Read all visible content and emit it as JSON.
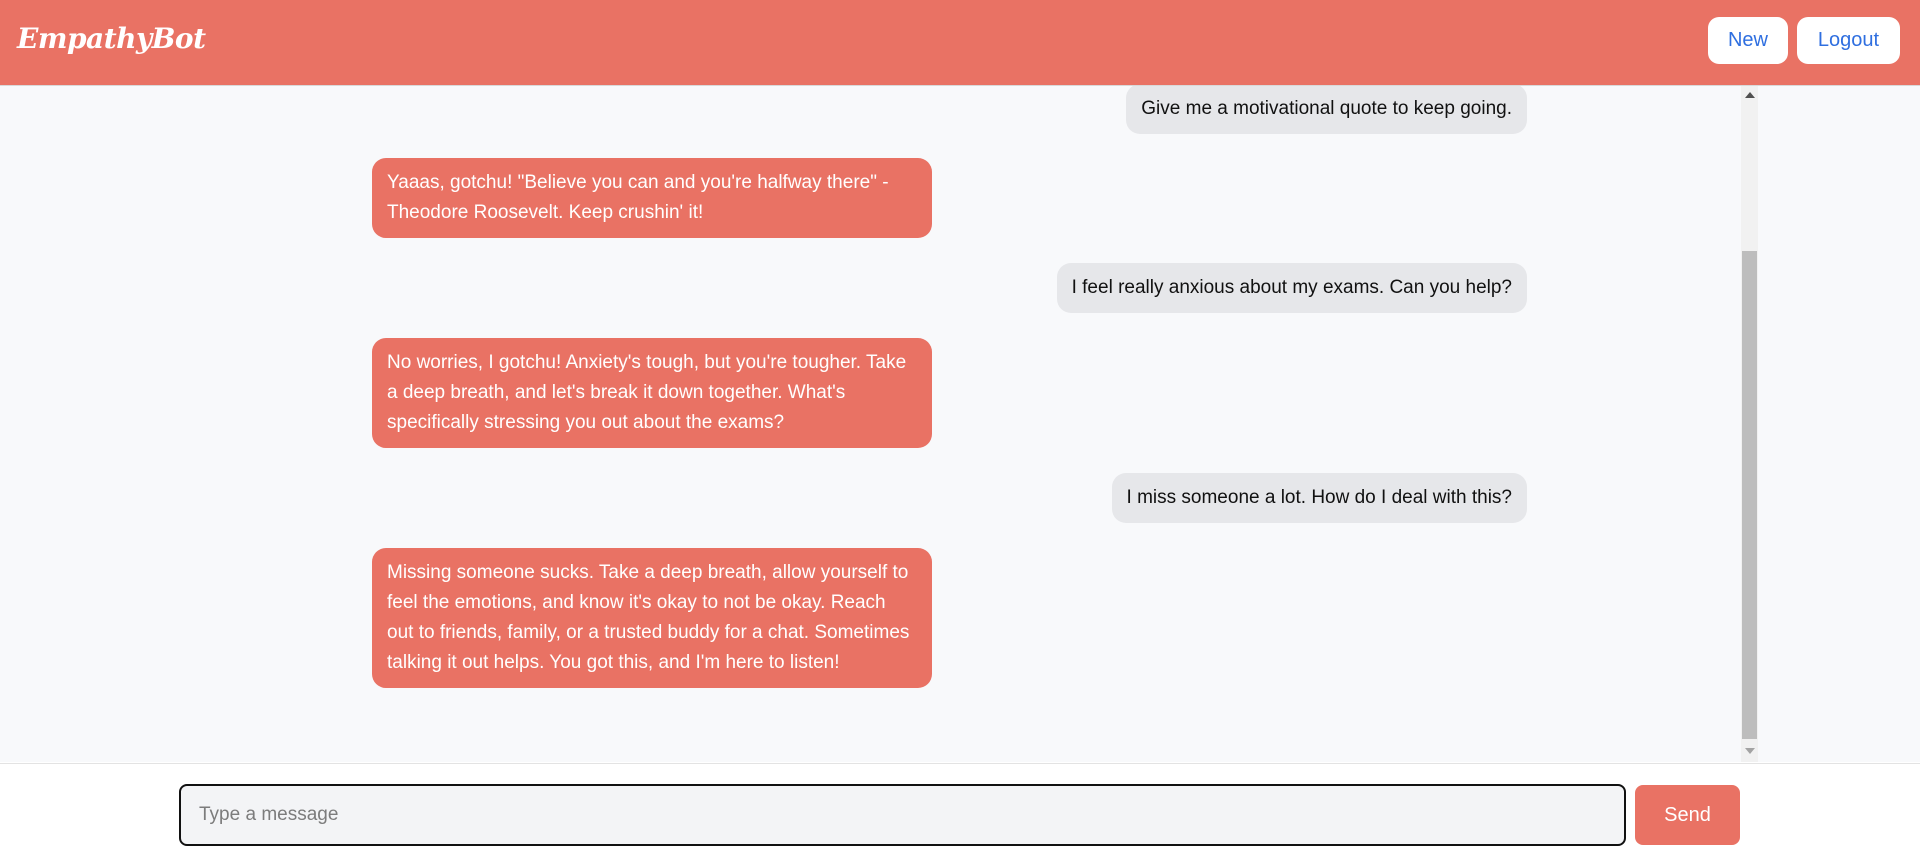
{
  "app": {
    "brand": "EmpathyBot"
  },
  "header": {
    "new_label": "New",
    "logout_label": "Logout"
  },
  "messages": [
    {
      "role": "user",
      "text": "Give me a motivational quote to keep going."
    },
    {
      "role": "bot",
      "text": "Yaaas, gotchu! \"Believe you can and you're halfway there\" - Theodore Roosevelt. Keep crushin' it!"
    },
    {
      "role": "user",
      "text": "I feel really anxious about my exams. Can you help?"
    },
    {
      "role": "bot",
      "text": "No worries, I gotchu! Anxiety's tough, but you're tougher. Take a deep breath, and let's break it down together. What's specifically stressing you out about the exams?"
    },
    {
      "role": "user",
      "text": "I miss someone a lot. How do I deal with this?"
    },
    {
      "role": "bot",
      "text": "Missing someone sucks. Take a deep breath, allow yourself to feel the emotions, and know it's okay to not be okay. Reach out to friends, family, or a trusted buddy for a chat. Sometimes talking it out helps. You got this, and I'm here to listen!"
    }
  ],
  "composer": {
    "placeholder": "Type a message",
    "value": "",
    "send_label": "Send"
  },
  "colors": {
    "accent": "#e97264",
    "user_bubble": "#e6e7ea",
    "chat_background": "#f8f9fb",
    "link_blue": "#2f6fe0"
  }
}
